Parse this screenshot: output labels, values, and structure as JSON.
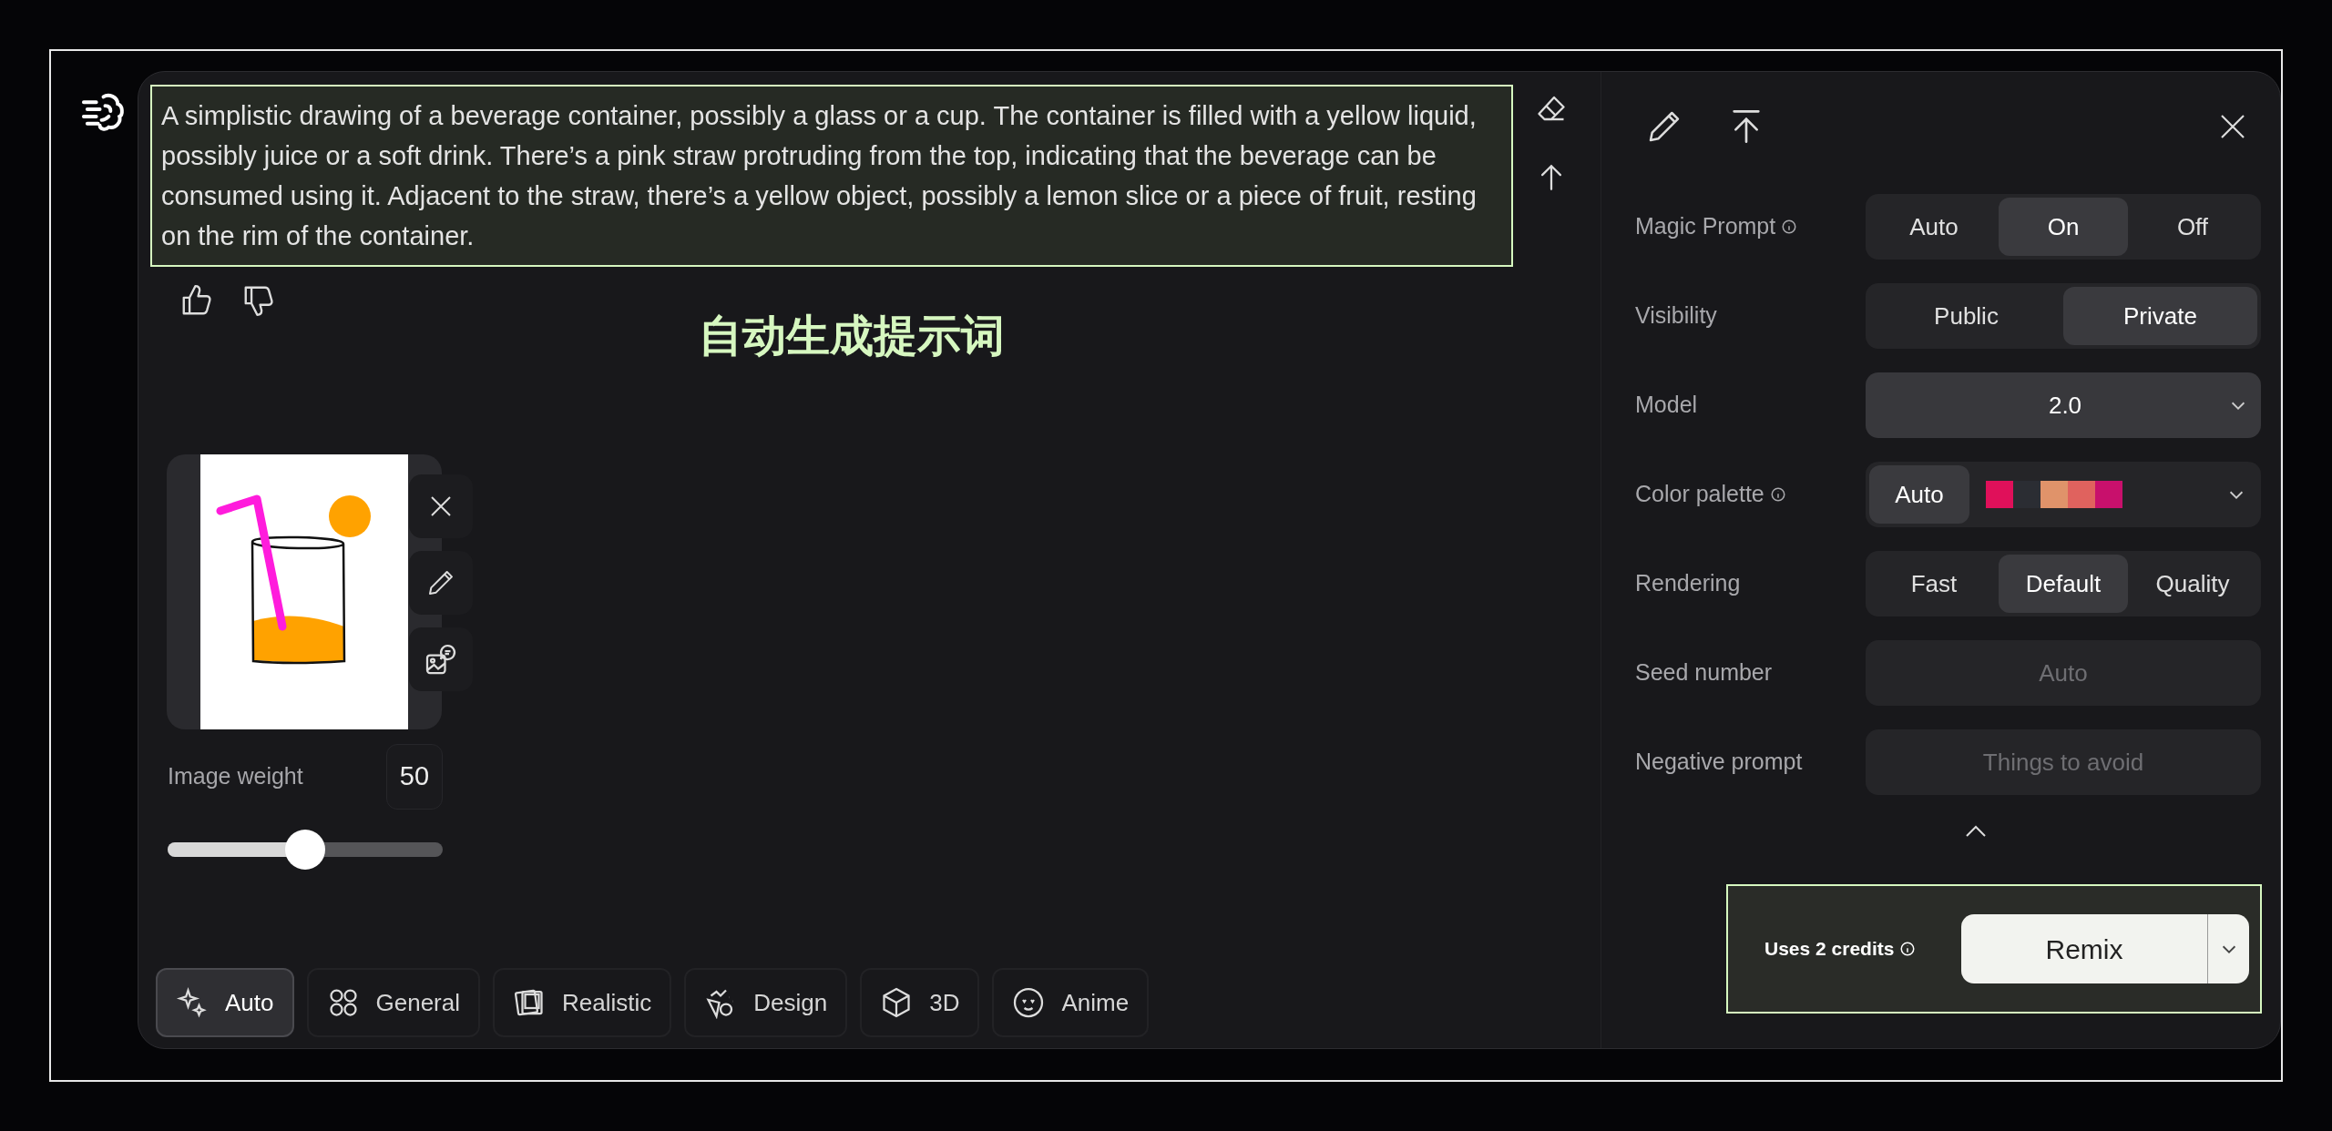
{
  "prompt": {
    "text": "A simplistic drawing of a beverage container, possibly a glass or a cup. The container is filled with a yellow liquid, possibly juice or a soft drink. There’s a pink straw protruding from the top, indicating that the beverage can be consumed using it. Adjacent to the straw, there’s a yellow object, possibly a lemon slice or a piece of fruit, resting on the rim of the container.",
    "highlighted": true
  },
  "annotation": "自动生成提示词",
  "image_prompt": {
    "weight_label": "Image weight",
    "weight_value": "50",
    "level": 0.5
  },
  "styles": [
    {
      "label": "Auto",
      "kind": "sparkle",
      "selected": true
    },
    {
      "label": "General",
      "kind": "grid",
      "selected": false
    },
    {
      "label": "Realistic",
      "kind": "photos",
      "selected": false
    },
    {
      "label": "Design",
      "kind": "design",
      "selected": false
    },
    {
      "label": "3D",
      "kind": "cube",
      "selected": false
    },
    {
      "label": "Anime",
      "kind": "face",
      "selected": false
    }
  ],
  "settings": [
    {
      "label": "Magic Prompt",
      "info": true,
      "kind": "segmented",
      "options": [
        {
          "label": "Auto",
          "selected": false
        },
        {
          "label": "On",
          "selected": true
        },
        {
          "label": "Off",
          "selected": false
        }
      ]
    },
    {
      "label": "Visibility",
      "info": false,
      "kind": "segmented",
      "options": [
        {
          "label": "Public",
          "selected": false
        },
        {
          "label": "Private",
          "selected": true
        }
      ]
    },
    {
      "label": "Model",
      "info": false,
      "kind": "select",
      "value": "2.0"
    },
    {
      "label": "Color palette",
      "info": true,
      "kind": "palette",
      "button": "Auto",
      "swatches": [
        {
          "color": "#e0105a"
        },
        {
          "color": "#2b2d33"
        },
        {
          "color": "#e0936a"
        },
        {
          "color": "#e0625e"
        },
        {
          "color": "#c8106c"
        }
      ]
    },
    {
      "label": "Rendering",
      "info": false,
      "kind": "segmented",
      "options": [
        {
          "label": "Fast",
          "selected": false
        },
        {
          "label": "Default",
          "selected": true
        },
        {
          "label": "Quality",
          "selected": false
        }
      ]
    },
    {
      "label": "Seed number",
      "info": false,
      "kind": "field",
      "placeholder": "Auto"
    },
    {
      "label": "Negative prompt",
      "info": false,
      "kind": "field",
      "placeholder": "Things to avoid"
    }
  ],
  "footer": {
    "credits": "Uses 2 credits",
    "info": true,
    "action": "Remix",
    "highlighted": true
  }
}
